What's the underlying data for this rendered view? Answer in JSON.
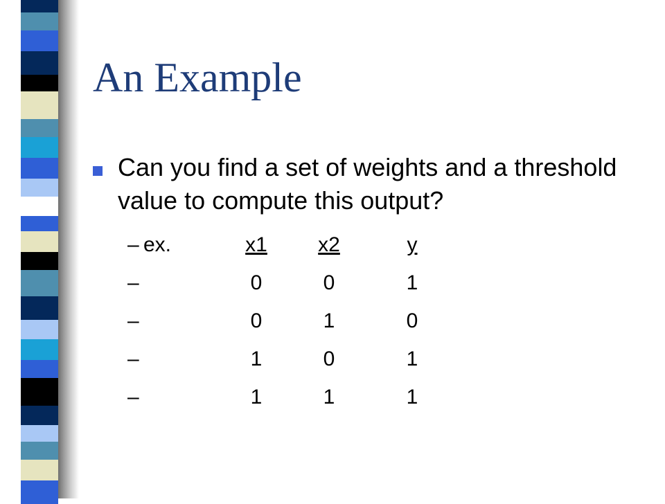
{
  "slide": {
    "title": "An Example",
    "bullet": "Can you find a set of weights and a threshold value to compute this output?",
    "dash": "–",
    "example_label": "ex."
  },
  "table": {
    "headers": [
      "x1",
      "x2",
      "y"
    ],
    "rows": [
      [
        "0",
        "0",
        "1"
      ],
      [
        "0",
        "1",
        "0"
      ],
      [
        "1",
        "0",
        "1"
      ],
      [
        "1",
        "1",
        "1"
      ]
    ]
  },
  "colors": {
    "title": "#1e3c78",
    "bullet": "#3a5fd6",
    "stripe": [
      "#04285a",
      "#4f8fae",
      "#2f5fd6",
      "#000000",
      "#e6e4bf",
      "#1aa1d6",
      "#a9c8f5",
      "#ffffff"
    ]
  }
}
